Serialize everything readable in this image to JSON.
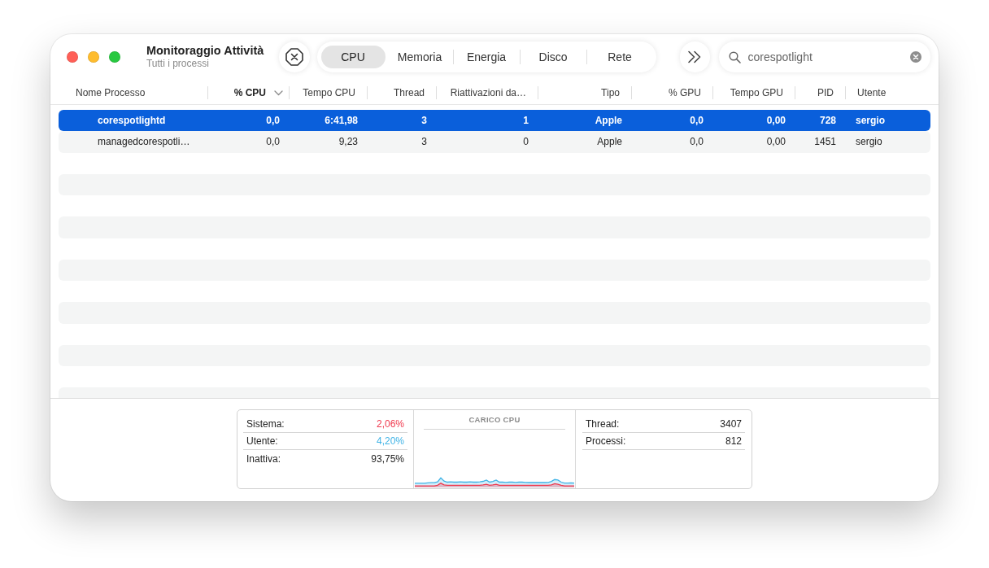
{
  "window": {
    "title": "Monitoraggio Attività",
    "subtitle": "Tutti i processi"
  },
  "toolbar": {
    "tabs": [
      {
        "label": "CPU",
        "selected": true
      },
      {
        "label": "Memoria",
        "selected": false
      },
      {
        "label": "Energia",
        "selected": false
      },
      {
        "label": "Disco",
        "selected": false
      },
      {
        "label": "Rete",
        "selected": false
      }
    ],
    "search": {
      "value": "corespotlight"
    }
  },
  "table": {
    "columns": [
      {
        "label": "Nome Processo",
        "sorted": false
      },
      {
        "label": "% CPU",
        "sorted": true
      },
      {
        "label": "Tempo CPU",
        "sorted": false
      },
      {
        "label": "Thread",
        "sorted": false
      },
      {
        "label": "Riattivazioni da…",
        "sorted": false
      },
      {
        "label": "Tipo",
        "sorted": false
      },
      {
        "label": "% GPU",
        "sorted": false
      },
      {
        "label": "Tempo GPU",
        "sorted": false
      },
      {
        "label": "PID",
        "sorted": false
      },
      {
        "label": "Utente",
        "sorted": false
      }
    ],
    "rows": [
      {
        "selected": true,
        "cells": [
          "corespotlightd",
          "0,0",
          "6:41,98",
          "3",
          "1",
          "Apple",
          "0,0",
          "0,00",
          "728",
          "sergio"
        ]
      },
      {
        "selected": false,
        "cells": [
          "managedcorespotli…",
          "0,0",
          "9,23",
          "3",
          "0",
          "Apple",
          "0,0",
          "0,00",
          "1451",
          "sergio"
        ]
      }
    ]
  },
  "cpu_summary": {
    "stats": [
      {
        "label": "Sistema:",
        "value": "2,06%",
        "color": "#f0384d"
      },
      {
        "label": "Utente:",
        "value": "4,20%",
        "color": "#3fb3e6"
      },
      {
        "label": "Inattiva:",
        "value": "93,75%",
        "color": "#222222"
      }
    ],
    "load_chart": {
      "title": "CARICO CPU"
    },
    "counts": [
      {
        "label": "Thread:",
        "value": "3407"
      },
      {
        "label": "Processi:",
        "value": "812"
      }
    ]
  }
}
